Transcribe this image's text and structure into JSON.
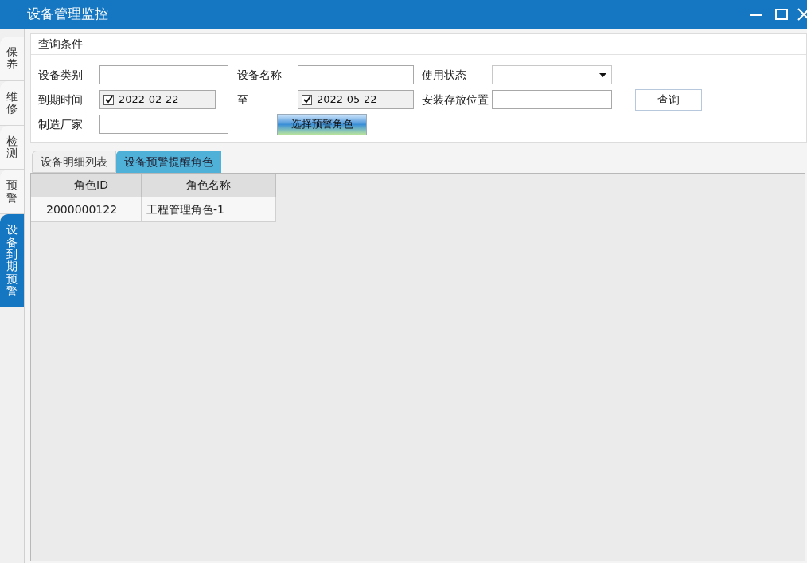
{
  "window": {
    "title": "设备管理监控"
  },
  "side_tabs": [
    {
      "label": "保养",
      "selected": false
    },
    {
      "label": "维修",
      "selected": false
    },
    {
      "label": "检测",
      "selected": false
    },
    {
      "label": "预警",
      "selected": false
    },
    {
      "label": "设备到期预警",
      "selected": true
    }
  ],
  "query_panel": {
    "title": "查询条件",
    "device_type": {
      "label": "设备类别"
    },
    "device_name": {
      "label": "设备名称"
    },
    "usage_status": {
      "label": "使用状态"
    },
    "expiry_from": {
      "label": "到期时间",
      "value": "2022-02-22",
      "checked": true
    },
    "expiry_to": {
      "label": "至",
      "value": "2022-05-22",
      "checked": true
    },
    "install_location": {
      "label": "安装存放位置"
    },
    "manufacturer": {
      "label": "制造厂家"
    },
    "select_role_button": "选择预警角色",
    "query_button": "查询"
  },
  "tabs": [
    {
      "label": "设备明细列表",
      "selected": false
    },
    {
      "label": "设备预警提醒角色",
      "selected": true
    }
  ],
  "table": {
    "columns": [
      "角色ID",
      "角色名称"
    ],
    "rows": [
      [
        "2000000122",
        "工程管理角色-1"
      ]
    ]
  }
}
